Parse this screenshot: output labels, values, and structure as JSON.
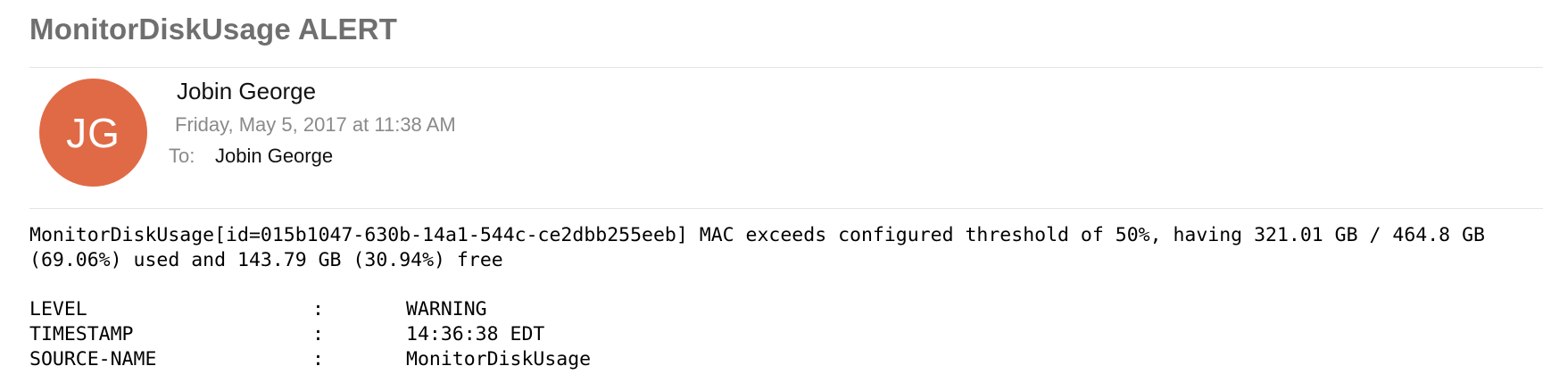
{
  "email": {
    "subject": "MonitorDiskUsage ALERT",
    "avatar_initials": "JG",
    "avatar_color": "#e06a45",
    "sender": "Jobin George",
    "date": "Friday, May 5, 2017 at 11:38 AM",
    "to_label": "To:",
    "to_value": "Jobin George",
    "body": "MonitorDiskUsage[id=015b1047-630b-14a1-544c-ce2dbb255eeb] MAC exceeds configured threshold of 50%, having 321.01 GB / 464.8 GB (69.06%) used and 143.79 GB (30.94%) free",
    "fields": [
      {
        "key": "LEVEL",
        "sep": ":",
        "value": "WARNING"
      },
      {
        "key": "TIMESTAMP",
        "sep": ":",
        "value": "14:36:38 EDT"
      },
      {
        "key": "SOURCE-NAME",
        "sep": ":",
        "value": "MonitorDiskUsage"
      }
    ]
  }
}
